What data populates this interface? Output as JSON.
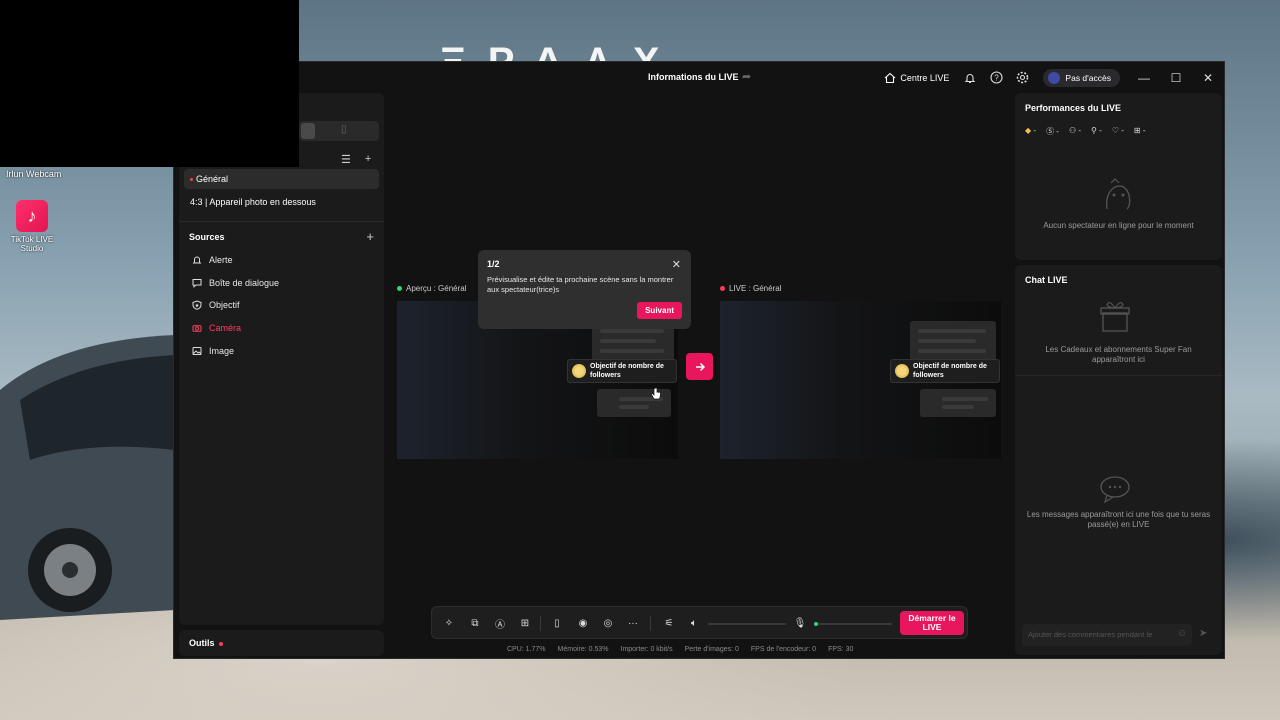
{
  "desktop": {
    "background_text": "ΞΡΔΛΧ",
    "webcam_label": "Irlun Webcam",
    "icon_label": "TikTok LIVE Studio"
  },
  "titlebar": {
    "title": "Informations du LIVE",
    "live_center": "Centre LIVE",
    "access": "Pas d'accès"
  },
  "scenes": {
    "items": [
      {
        "label": "Général",
        "active": true
      },
      {
        "label": "4:3 | Appareil photo en dessous",
        "active": false
      }
    ]
  },
  "sources": {
    "header": "Sources",
    "items": [
      {
        "label": "Alerte",
        "icon": "bell-icon"
      },
      {
        "label": "Boîte de dialogue",
        "icon": "chat-icon"
      },
      {
        "label": "Objectif",
        "icon": "shield-icon"
      },
      {
        "label": "Caméra",
        "icon": "camera-icon"
      },
      {
        "label": "Image",
        "icon": "image-icon"
      }
    ]
  },
  "tools": {
    "label": "Outils"
  },
  "preview": {
    "left_label": "Aperçu : Général",
    "right_label": "LIVE : Général",
    "goal_text_line1": "Objectif de nombre de",
    "goal_text_line2": "followers"
  },
  "tooltip": {
    "step": "1/2",
    "message": "Prévisualise et édite ta prochaine scène sans la montrer aux spectateur(trice)s",
    "next": "Suivant"
  },
  "controls": {
    "go_live_line1": "Démarrer le",
    "go_live_line2": "LIVE"
  },
  "stats": {
    "cpu": "CPU:  1.77%",
    "memory": "Mémoire:  0.53%",
    "import": "Importer:  0 kbit/s",
    "dropped": "Perte d'images:  0",
    "encoder_fps": "FPS de l'encodeur:  0",
    "fps": "FPS:  30"
  },
  "performance": {
    "title": "Performances du LIVE",
    "metrics": [
      "-",
      "-",
      "-",
      "-",
      "-",
      "-"
    ],
    "empty": "Aucun spectateur en ligne pour le moment"
  },
  "chat": {
    "title": "Chat LIVE",
    "gifts_empty": "Les Cadeaux et abonnements Super Fan apparaîtront ici",
    "messages_empty": "Les messages apparaîtront ici une fois que tu seras passé(e) en LIVE",
    "comment_placeholder": "Ajouter des commentaires pendant le"
  },
  "colors": {
    "accent": "#e8175d",
    "preview_dot": "#2fd57c",
    "live_dot": "#ff3b5c"
  }
}
